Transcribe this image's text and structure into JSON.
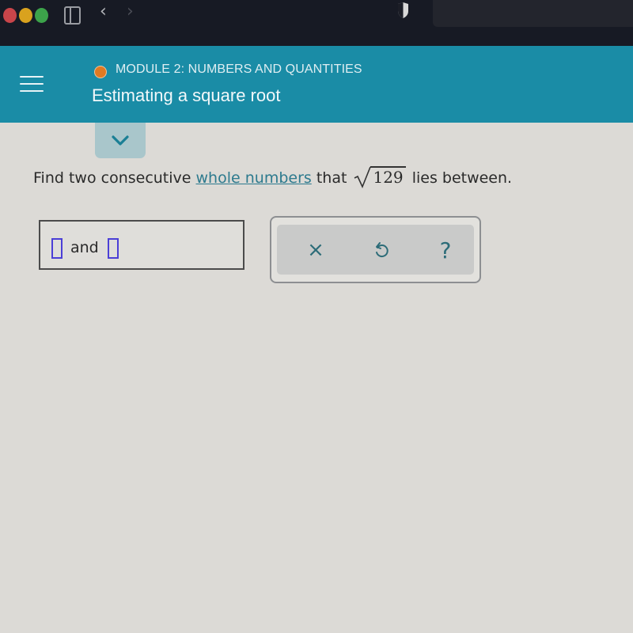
{
  "browser": {
    "icons": [
      "close-dot",
      "minimize-dot",
      "zoom-dot",
      "sidebar-icon",
      "chevron-left-icon",
      "chevron-right-icon",
      "shield-icon"
    ],
    "back_glyph": "‹",
    "forward_glyph": "›"
  },
  "header": {
    "module_label": "MODULE 2: NUMBERS AND QUANTITIES",
    "lesson_title": "Estimating a square root",
    "status_color": "#e07a22",
    "brand_color": "#1a8ca6"
  },
  "question": {
    "prefix": "Find two consecutive ",
    "link_text": "whole numbers",
    "middle": " that ",
    "radicand": "129",
    "suffix": " lies between."
  },
  "answer": {
    "connector": "and",
    "first_value": "",
    "second_value": ""
  },
  "tools": {
    "clear_glyph": "×",
    "help_glyph": "?"
  }
}
